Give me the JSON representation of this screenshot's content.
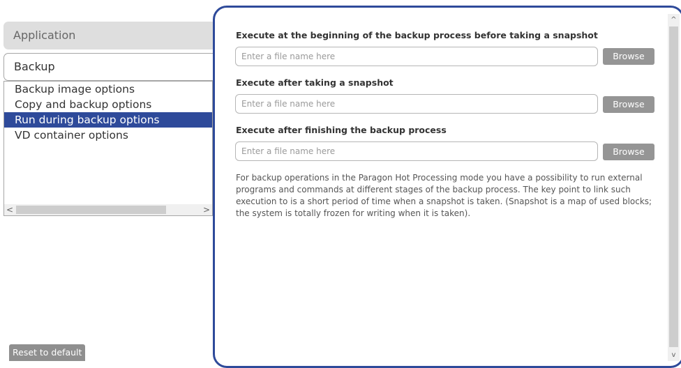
{
  "sidebar": {
    "category_header": "Application",
    "selected_category": "Backup",
    "sub_items": [
      {
        "label": "Backup image options"
      },
      {
        "label": "Copy and backup options"
      },
      {
        "label": "Run during backup options",
        "active": true
      },
      {
        "label": "VD container options"
      }
    ],
    "scroll_left_glyph": "<",
    "scroll_right_glyph": ">",
    "reset_label": "Reset to default"
  },
  "panel": {
    "scroll_up_glyph": "^",
    "scroll_down_glyph": "v",
    "sections": [
      {
        "label": "Execute at the beginning of the backup process before taking a snapshot",
        "placeholder": "Enter a file name here",
        "value": "",
        "browse_label": "Browse"
      },
      {
        "label": "Execute after taking a snapshot",
        "placeholder": "Enter a file name here",
        "value": "",
        "browse_label": "Browse"
      },
      {
        "label": "Execute after finishing the backup process",
        "placeholder": "Enter a file name here",
        "value": "",
        "browse_label": "Browse"
      }
    ],
    "description": "For backup operations in the Paragon Hot Processing mode you have a possibility to run external programs and commands at different stages of the backup process. The key point to link such execution to is a short period of time when a snapshot is taken. (Snapshot is a map of used blocks; the system is totally frozen for writing when it is taken)."
  },
  "colors": {
    "accent": "#2e4a9a",
    "button_gray": "#959595",
    "category_bg": "#dedede"
  }
}
